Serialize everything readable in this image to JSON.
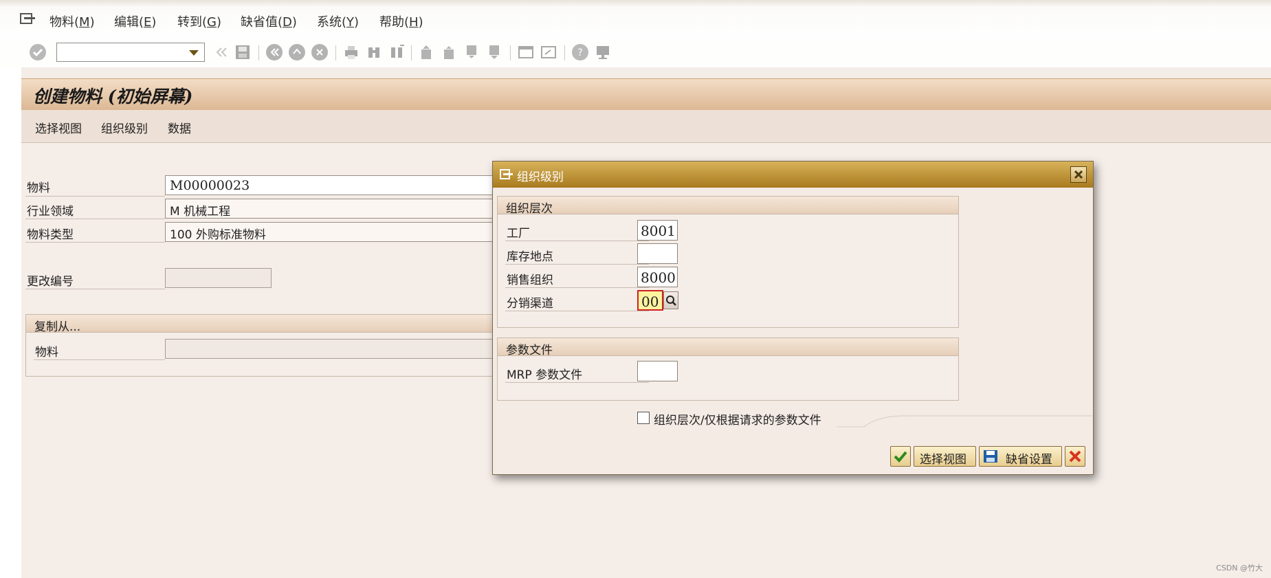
{
  "menu": {
    "items": [
      {
        "text": "物料(",
        "key": "M",
        "end": ")"
      },
      {
        "text": "编辑(",
        "key": "E",
        "end": ")"
      },
      {
        "text": "转到(",
        "key": "G",
        "end": ")"
      },
      {
        "text": "缺省值(",
        "key": "D",
        "end": ")"
      },
      {
        "text": "系统(",
        "key": "Y",
        "end": ")"
      },
      {
        "text": "帮助(",
        "key": "H",
        "end": ")"
      }
    ]
  },
  "page": {
    "title": "创建物料 (初始屏幕)"
  },
  "app_toolbar": {
    "select_views": "选择视图",
    "org_levels": "组织级别",
    "data": "数据"
  },
  "form": {
    "material_label": "物料",
    "material_value": "M00000023",
    "industry_label": "行业领域",
    "industry_value": "M 机械工程",
    "type_label": "物料类型",
    "type_value": "100 外购标准物料",
    "change_no_label": "更改编号",
    "change_no_value": "",
    "copy_from_title": "复制从...",
    "copy_material_label": "物料",
    "copy_material_value": ""
  },
  "dialog": {
    "title": "组织级别",
    "org_levels_header": "组织层次",
    "plant_label": "工厂",
    "plant_value": "8001",
    "storage_label": "库存地点",
    "storage_value": "",
    "sales_org_label": "销售组织",
    "sales_org_value": "8000",
    "dist_channel_label": "分销渠道",
    "dist_channel_value": "00",
    "profiles_header": "参数文件",
    "mrp_label": "MRP 参数文件",
    "mrp_value": "",
    "checkbox_label": "组织层次/仅根据请求的参数文件",
    "checkbox_checked": false,
    "btn_select_views": "选择视图",
    "btn_default_settings": "缺省设置"
  },
  "watermark": "CSDN @竹大",
  "colors": {
    "title_bar": "#dcb894",
    "dialog_title": "#a87a1e",
    "active_field": "#fdf4a0"
  }
}
